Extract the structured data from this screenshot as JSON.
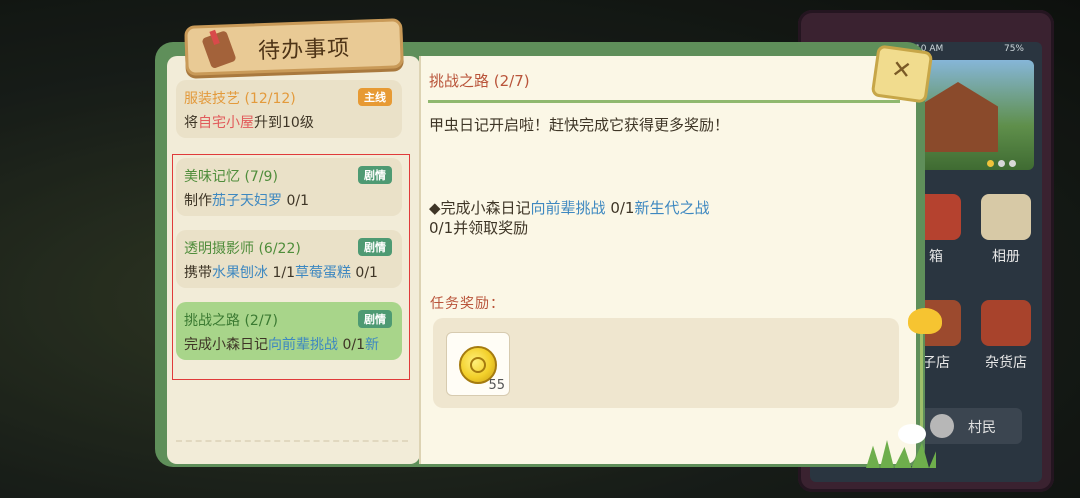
{
  "title": "待办事项",
  "tasks": [
    {
      "name": "服装技艺 (12/12)",
      "badge": "主线",
      "desc_pre": "将",
      "desc_hl": "自宅小屋",
      "desc_post": "升到10级"
    },
    {
      "name": "美味记忆 (7/9)",
      "badge": "剧情",
      "desc_pre": "制作",
      "desc_hl": "茄子天妇罗",
      "desc_post": " 0/1"
    },
    {
      "name": "透明摄影师 (6/22)",
      "badge": "剧情",
      "desc_pre": "携带",
      "desc_hl": "水果刨冰",
      "desc_mid": " 1/1",
      "desc_hl2": "草莓蛋糕",
      "desc_post": " 0/1"
    },
    {
      "name": "挑战之路 (2/7)",
      "badge": "剧情",
      "desc_pre": "完成小森日记",
      "desc_hl": "向前辈挑战",
      "desc_mid": " 0/1",
      "desc_hl2": "新",
      "desc_post": ""
    }
  ],
  "detail": {
    "title": "挑战之路 (2/7)",
    "line1": "甲虫日记开启啦！赶快完成它获得更多奖励！",
    "line2_pre": "◆完成小森日记",
    "line2_hl1": "向前辈挑战",
    "line2_mid": " 0/1",
    "line2_hl2": "新生代之战",
    "line2_post": "0/1并领取奖励",
    "reward_label": "任务奖励：",
    "reward_count": "55"
  },
  "phone": {
    "time": "10 AM",
    "battery": "75%",
    "apps": [
      "箱",
      "相册",
      "子店",
      "杂货店"
    ],
    "villager": "村民"
  },
  "close_symbol": "✕"
}
